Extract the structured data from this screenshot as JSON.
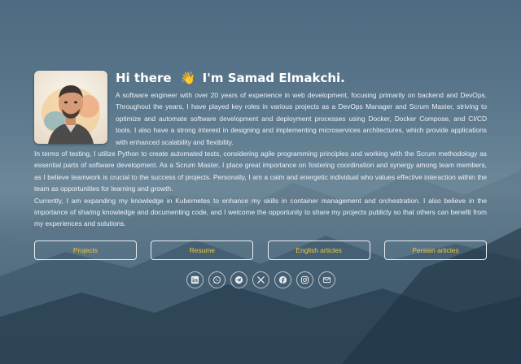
{
  "profile": {
    "greeting_prefix": "Hi there",
    "wave_emoji": "👋",
    "greeting_name": "I'm Samad Elmakchi.",
    "avatar_icon": "portrait-illustration"
  },
  "about": {
    "paragraph1": "A software engineer with over 20 years of experience in web development, focusing primarily on backend and DevOps. Throughout the years, I have played key roles in various projects as a DevOps Manager and Scrum Master, striving to optimize and automate software development and deployment processes using Docker, Docker Compose, and CI/CD tools. I also have a strong interest in designing and implementing microservices architectures, which provide applications with enhanced scalability and flexibility.",
    "paragraph2": "In terms of testing, I utilize Python to create automated tests, considering agile programming principles and working with the Scrum methodology as essential parts of software development. As a Scrum Master, I place great importance on fostering coordination and synergy among team members, as I believe teamwork is crucial to the success of projects. Personally, I am a calm and energetic individual who values effective interaction within the team as opportunities for learning and growth.",
    "paragraph3": "Currently, I am expanding my knowledge in Kubernetes to enhance my skills in container management and orchestration. I also believe in the importance of sharing knowledge and documenting code, and I welcome the opportunity to share my projects publicly so that others can benefit from my experiences and solutions."
  },
  "buttons": {
    "projects": "Projects",
    "resume": "Resume",
    "english_articles": "English articles",
    "persian_articles": "Persian articles"
  },
  "social_icons": [
    "linkedin-icon",
    "whatsapp-icon",
    "telegram-icon",
    "x-twitter-icon",
    "facebook-icon",
    "instagram-icon",
    "email-icon"
  ],
  "colors": {
    "button_text": "#f0c840",
    "button_border": "#e8edf2",
    "heading": "#ffffff"
  }
}
